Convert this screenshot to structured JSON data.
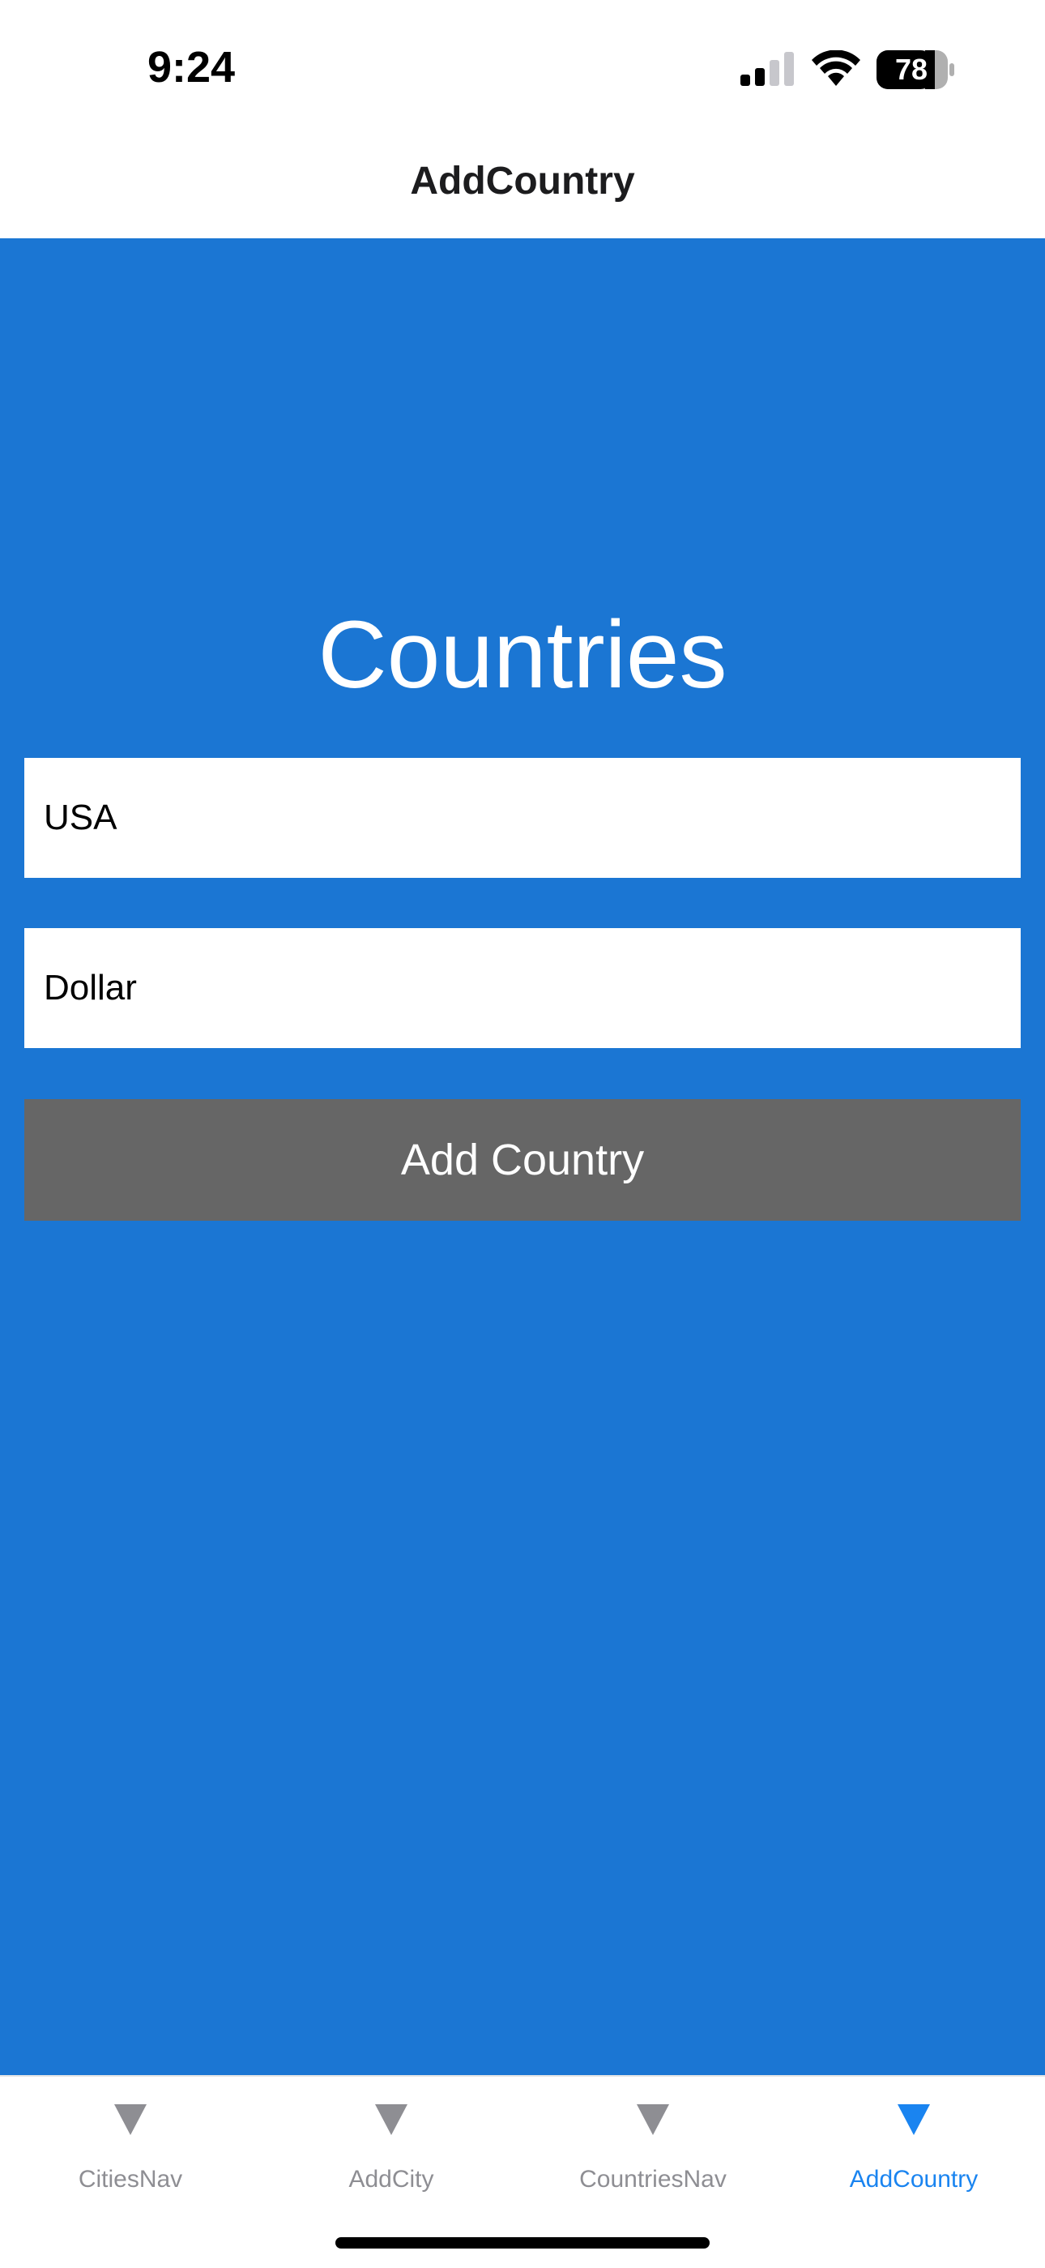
{
  "status_bar": {
    "time": "9:24",
    "battery_level": "78",
    "icons": [
      "signal-icon",
      "wifi-icon",
      "battery-icon"
    ]
  },
  "nav": {
    "title": "AddCountry"
  },
  "main": {
    "heading": "Countries",
    "country_name_value": "USA",
    "currency_value": "Dollar",
    "add_button_label": "Add Country",
    "background_color": "#1b76d3",
    "button_color": "#666666"
  },
  "tab_bar": {
    "active_color": "#1a84f0",
    "inactive_color": "#8e8e93",
    "tabs": [
      {
        "label": "CitiesNav",
        "icon": "triangle-down-icon",
        "active": false
      },
      {
        "label": "AddCity",
        "icon": "triangle-down-icon",
        "active": false
      },
      {
        "label": "CountriesNav",
        "icon": "triangle-down-icon",
        "active": false
      },
      {
        "label": "AddCountry",
        "icon": "triangle-down-icon",
        "active": true
      }
    ]
  }
}
